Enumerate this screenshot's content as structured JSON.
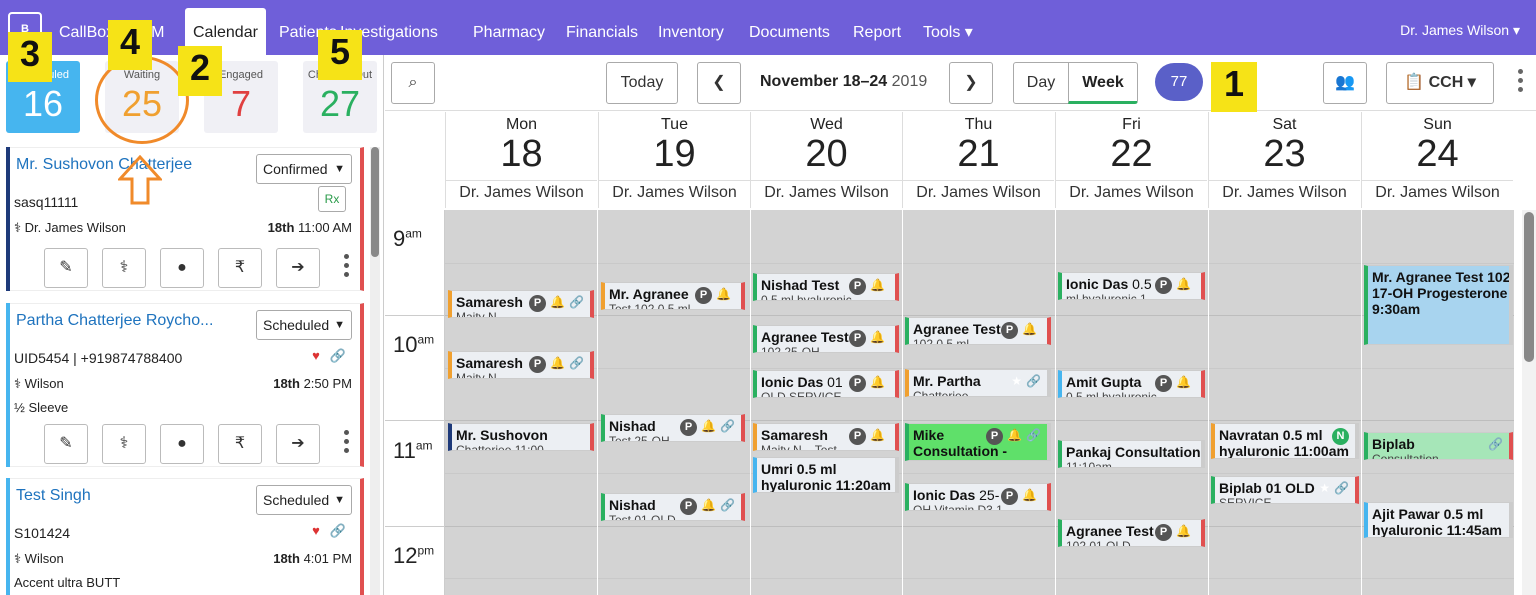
{
  "navbar": {
    "logo": "B",
    "items": [
      "CallBox",
      "CRM",
      "Calendar",
      "Patients",
      "Investigations",
      "Pharmacy",
      "Financials",
      "Inventory",
      "Documents",
      "Report",
      "Tools ▾"
    ],
    "active": "Calendar",
    "user": "Dr. James Wilson ▾",
    "bg_color": "#6f5fd9"
  },
  "counters": {
    "scheduled": {
      "label": "Scheduled",
      "value": "16"
    },
    "waiting": {
      "label": "Waiting",
      "value": "25"
    },
    "engaged": {
      "label": "Engaged",
      "value": "7"
    },
    "checked_out": {
      "label": "Checked Out",
      "value": "27"
    }
  },
  "cards": [
    {
      "name": "Mr. Sushovon Chatterjee",
      "status": "Confirmed",
      "id": "sasq11111",
      "doctor": "Dr. James Wilson",
      "date": "18th",
      "time": "11:00 AM",
      "rx": "Rx",
      "accent": "#1e3a7a"
    },
    {
      "name": "Partha Chatterjee Roycho...",
      "status": "Scheduled",
      "id": "UID5454 | +919874788400",
      "doctor": "Wilson",
      "date": "18th",
      "time": "2:50 PM",
      "extra": "½ Sleeve",
      "accent": "#46b5ef"
    },
    {
      "name": "Test Singh",
      "status": "Scheduled",
      "id": "S101424",
      "doctor": "Wilson",
      "date": "18th",
      "time": "4:01 PM",
      "extra": "Accent ultra BUTT",
      "accent": "#46b5ef"
    }
  ],
  "card_actions": [
    "edit-icon",
    "doctor-icon",
    "person-icon",
    "rupee-icon",
    "arrow-right-icon"
  ],
  "toolbar": {
    "today": "Today",
    "range_bold": "November 18–24",
    "range_year": "2019",
    "day": "Day",
    "week": "Week",
    "count": "77",
    "location": "CCH"
  },
  "days": [
    {
      "dow": "Mon",
      "date": "18",
      "doctor": "Dr. James Wilson"
    },
    {
      "dow": "Tue",
      "date": "19",
      "doctor": "Dr. James Wilson"
    },
    {
      "dow": "Wed",
      "date": "20",
      "doctor": "Dr. James Wilson"
    },
    {
      "dow": "Thu",
      "date": "21",
      "doctor": "Dr. James Wilson"
    },
    {
      "dow": "Fri",
      "date": "22",
      "doctor": "Dr. James Wilson"
    },
    {
      "dow": "Sat",
      "date": "23",
      "doctor": "Dr. James Wilson"
    },
    {
      "dow": "Sun",
      "date": "24",
      "doctor": "Dr. James Wilson"
    }
  ],
  "times": [
    {
      "h": "9",
      "ap": "am"
    },
    {
      "h": "10",
      "ap": "am"
    },
    {
      "h": "11",
      "ap": "am"
    },
    {
      "h": "12",
      "ap": "pm"
    }
  ],
  "events": [
    {
      "title": "Samaresh",
      "sub": "Maity N...",
      "p": "P"
    },
    {
      "title": "Samaresh",
      "sub": "Maity N...",
      "p": "P"
    },
    {
      "title": "Mr. Sushovon",
      "sub": "Chatterjee 11:00..."
    },
    {
      "title": "Mr. Agranee",
      "sub": "Test 102 0.5 ml...",
      "p": "P"
    },
    {
      "title": "Nishad",
      "sub": "Test 25-OH...",
      "p": "P"
    },
    {
      "title": "Nishad",
      "sub": "Test 01 OLD...",
      "p": "P"
    },
    {
      "title": "Nishad Test",
      "sub": "0.5 ml hyaluronic...",
      "p": "P"
    },
    {
      "title": "Agranee Test",
      "sub": "102 25-OH...",
      "p": "P"
    },
    {
      "title": "Ionic Das",
      "title2": " 01",
      "sub": "OLD SERVICE...",
      "p": "P"
    },
    {
      "title": "Samaresh",
      "sub": "Maity N... Test...",
      "p": "P"
    },
    {
      "title": "Umri 0.5 ml",
      "sub": "hyaluronic 11:20am"
    },
    {
      "title": "Agranee Test",
      "sub": "102 0.5 ml...",
      "p": "P"
    },
    {
      "title": "Mr. Partha",
      "sub": "Chatterjee..."
    },
    {
      "title": "Mike",
      "sub": "Consultation -",
      "p": "P"
    },
    {
      "title": "Ionic Das",
      "title2": " 25-",
      "sub": "OH Vitamin D3 1...",
      "p": "P"
    },
    {
      "title": "Ionic Das",
      "title2": " 0.5",
      "sub": "ml hyaluronic 1...",
      "p": "P"
    },
    {
      "title": "Amit Gupta",
      "sub": "0.5 ml hyaluronic...",
      "p": "P"
    },
    {
      "title": "Pankaj Consultation A",
      "sub": "11:10am"
    },
    {
      "title": "Agranee Test",
      "sub": "102 01 OLD...",
      "p": "P"
    },
    {
      "title": "Navratan 0.5 ml",
      "sub": "hyaluronic 11:00am",
      "n": "N"
    },
    {
      "title": "Biplab 01 OLD",
      "sub": "SERVICE..."
    },
    {
      "title": "Mr. Agranee Test 102",
      "sub": "17-OH Progesterone",
      "sub2": "9:30am"
    },
    {
      "title": "Biplab",
      "sub": "Consultation..."
    },
    {
      "title": "Ajit Pawar 0.5 ml",
      "sub": "hyaluronic 11:45am"
    }
  ],
  "annotations": [
    "1",
    "2",
    "3",
    "4",
    "5"
  ]
}
